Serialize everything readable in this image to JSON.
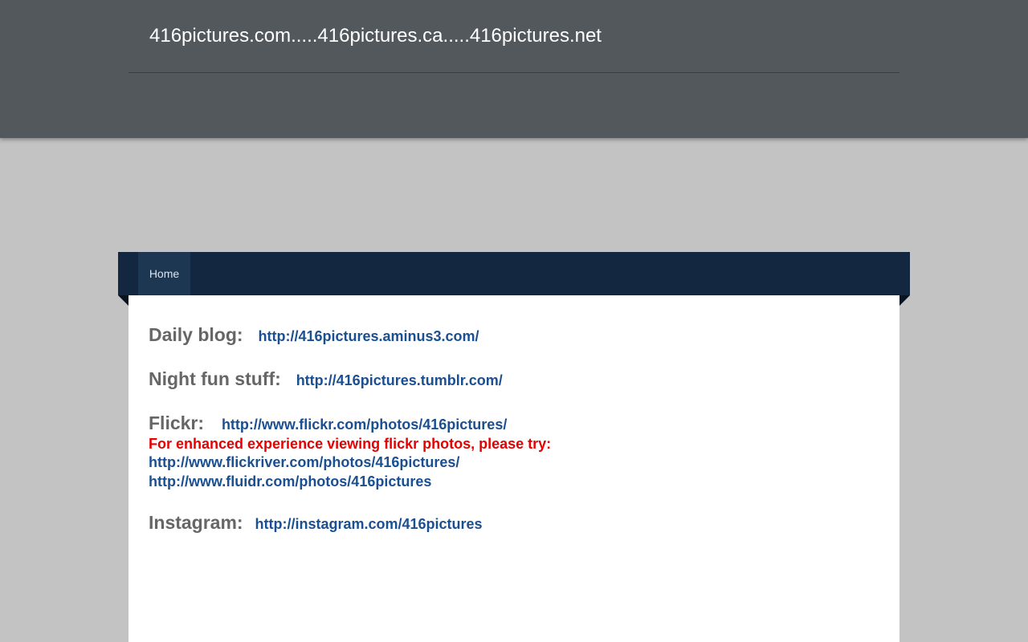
{
  "header": {
    "title": "416pictures.com.....416pictures.ca.....416pictures.net"
  },
  "nav": {
    "items": [
      {
        "label": "Home"
      }
    ]
  },
  "content": {
    "daily_blog": {
      "label": "Daily blog:",
      "url": "http://416pictures.aminus3.com/"
    },
    "night_fun": {
      "label": "Night fun stuff:",
      "url": "http://416pictures.tumblr.com/"
    },
    "flickr": {
      "label": "Flickr:",
      "url": "http://www.flickr.com/photos/416pictures/",
      "note": "For enhanced experience viewing flickr photos, please try:",
      "alt_links": [
        "http://www.flickriver.com/photos/416pictures/",
        "http://www.fluidr.com/photos/416pictures"
      ]
    },
    "instagram": {
      "label": "Instagram:",
      "url": "http://instagram.com/416pictures"
    }
  },
  "colors": {
    "header_bg": "#53585d",
    "page_bg": "#c3c3c3",
    "nav_bg": "#132840",
    "nav_active_bg": "#1d3651",
    "link": "#1a4f91",
    "label": "#666666",
    "note": "#e60000"
  }
}
